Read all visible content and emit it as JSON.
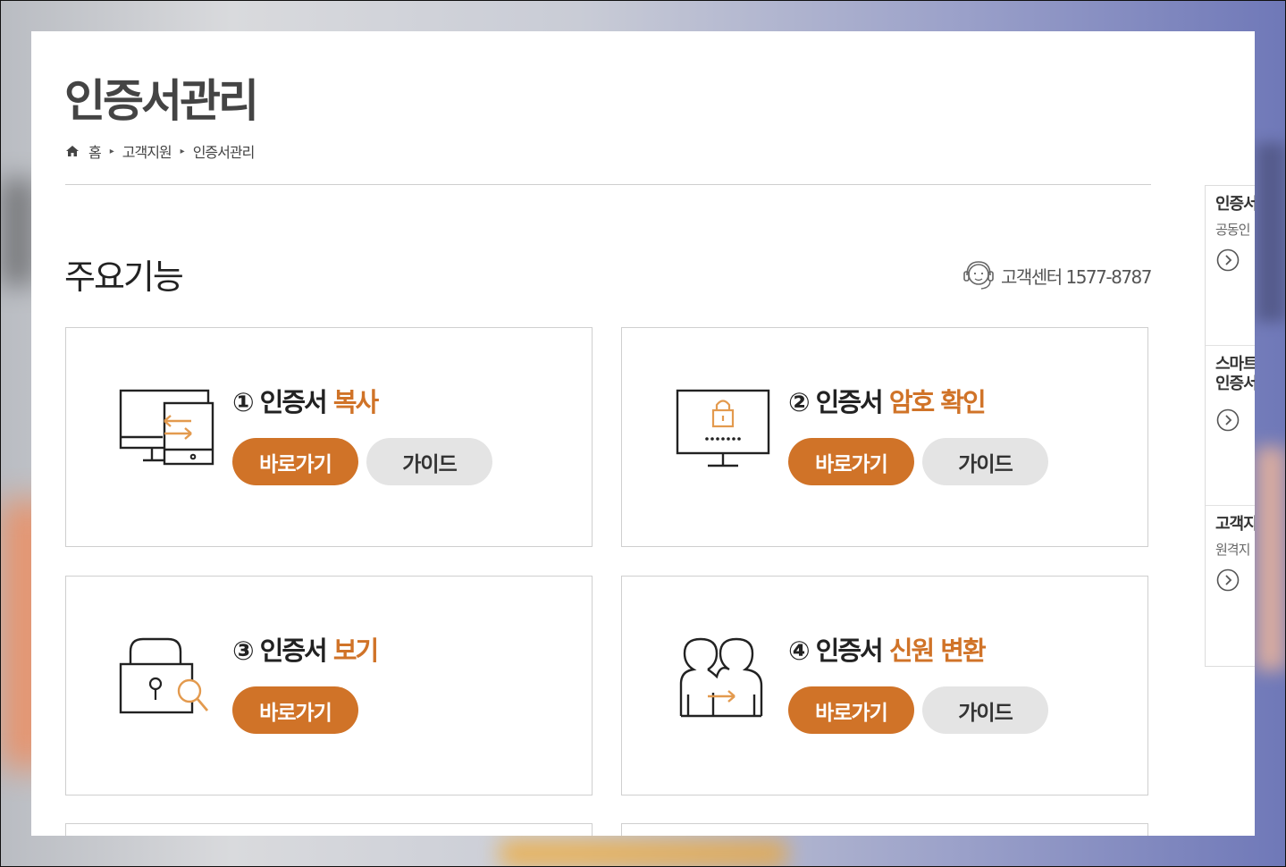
{
  "page": {
    "title": "인증서관리",
    "breadcrumb": [
      "홈",
      "고객지원",
      "인증서관리"
    ]
  },
  "section": {
    "title": "주요기능",
    "customer_center": "고객센터 1577-8787"
  },
  "cards": [
    {
      "number": "①",
      "prefix": "인증서",
      "highlight": "복사",
      "go_label": "바로가기",
      "guide_label": "가이드",
      "icon": "monitor-transfer-icon"
    },
    {
      "number": "②",
      "prefix": "인증서",
      "highlight": "암호 확인",
      "go_label": "바로가기",
      "guide_label": "가이드",
      "icon": "monitor-lock-password-icon"
    },
    {
      "number": "③",
      "prefix": "인증서",
      "highlight": "보기",
      "go_label": "바로가기",
      "icon": "lock-search-icon"
    },
    {
      "number": "④",
      "prefix": "인증서",
      "highlight": "신원 변환",
      "go_label": "바로가기",
      "guide_label": "가이드",
      "icon": "people-transfer-icon"
    }
  ],
  "sidebar": {
    "items": [
      {
        "title": "인증서",
        "subtitle": "공동인"
      },
      {
        "title": "스마트\n인증서",
        "subtitle": ""
      },
      {
        "title": "고객지",
        "subtitle": "원격지"
      }
    ]
  },
  "colors": {
    "accent": "#d07328",
    "guide_bg": "#e4e4e4",
    "text": "#222222"
  }
}
